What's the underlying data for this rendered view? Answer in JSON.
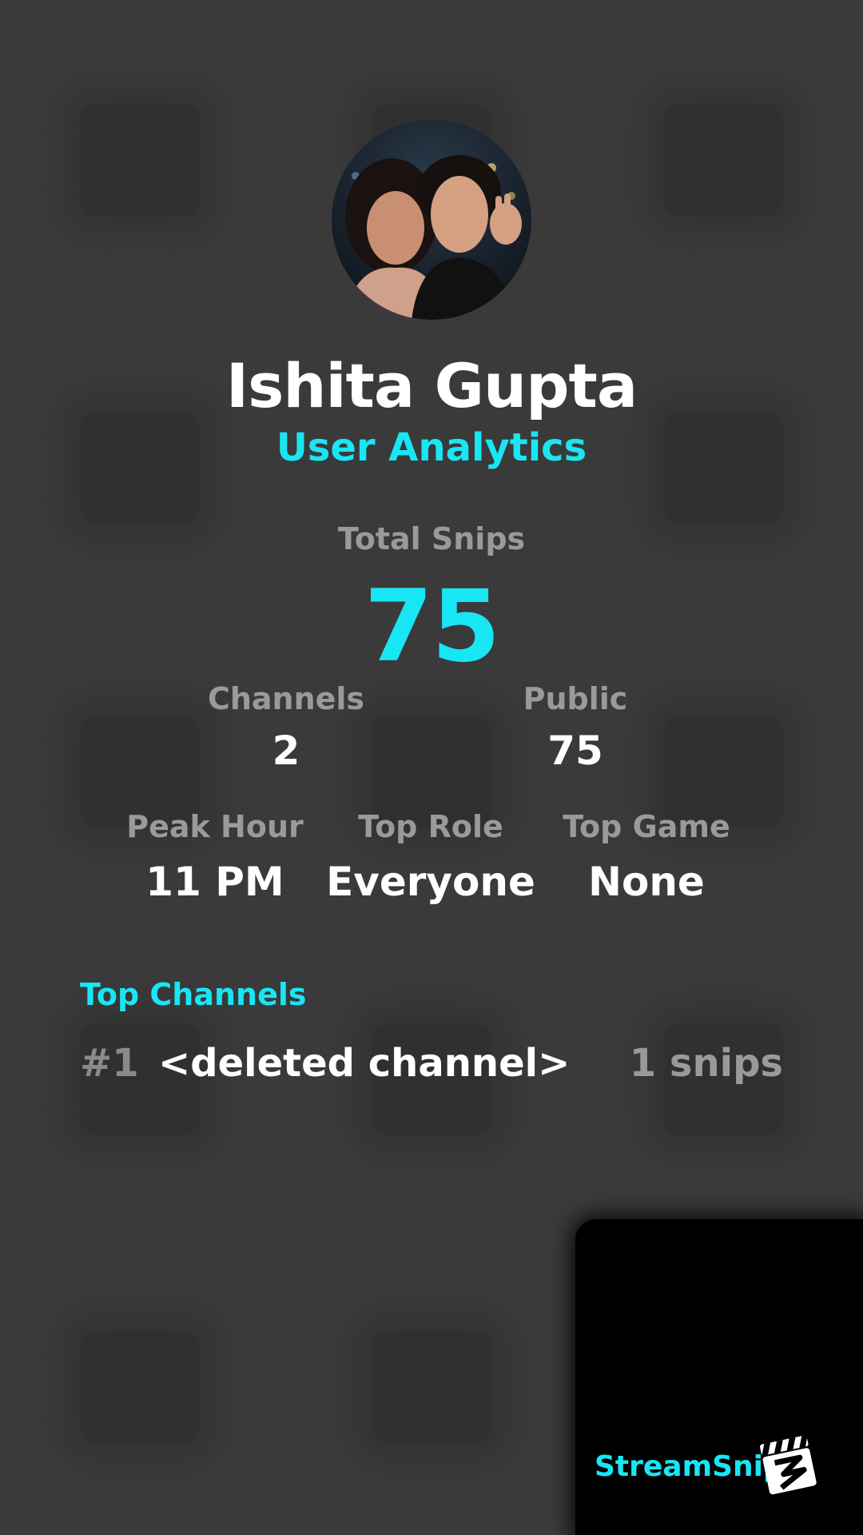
{
  "profile": {
    "name": "Ishita Gupta",
    "subtitle": "User Analytics"
  },
  "totals": {
    "total_label": "Total Snips",
    "total_value": "75"
  },
  "stats_row1": [
    {
      "label": "Channels",
      "value": "2"
    },
    {
      "label": "Public",
      "value": "75"
    }
  ],
  "stats_row2": [
    {
      "label": "Peak Hour",
      "value": "11 PM"
    },
    {
      "label": "Top Role",
      "value": "Everyone"
    },
    {
      "label": "Top Game",
      "value": "None"
    }
  ],
  "top_channels": {
    "title": "Top Channels",
    "items": [
      {
        "rank": "#1",
        "name": "<deleted channel>",
        "count": "1 snips"
      }
    ]
  },
  "brand": {
    "name": "StreamSnip"
  },
  "colors": {
    "accent": "#19e6f5",
    "background": "#3a3a3a",
    "muted_text": "#9a9a9a"
  }
}
